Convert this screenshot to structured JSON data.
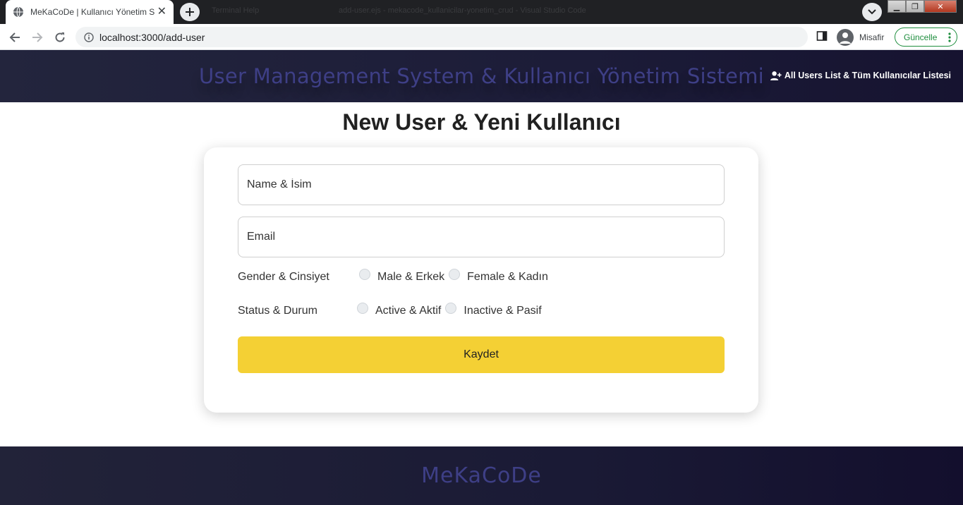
{
  "browser": {
    "tab_title": "MeKaCoDe | Kullanıcı Yönetim Sistemi",
    "url": "localhost:3000/add-user",
    "profile_name": "Misafir",
    "update_label": "Güncelle",
    "ghost_text_1": "Terminal Help",
    "ghost_text_2": "add-user.ejs - mekacode_kullanicilar-yonetim_crud - Visual Studio Code"
  },
  "header": {
    "site_title": "User Management System & Kullanıcı Yönetim Sistemi",
    "nav_link": "All Users List & Tüm Kullanıcılar Listesi"
  },
  "form": {
    "heading": "New User & Yeni Kullanıcı",
    "name_placeholder": "Name & İsim",
    "email_placeholder": "Email",
    "gender_label": "Gender & Cinsiyet",
    "gender_options": [
      "Male & Erkek",
      "Female & Kadın"
    ],
    "status_label": "Status & Durum",
    "status_options": [
      "Active & Aktif",
      "Inactive & Pasif"
    ],
    "submit_label": "Kaydet"
  },
  "footer": {
    "brand": "MeKaCoDe"
  },
  "colors": {
    "header_bg": "#1c1c38",
    "title_color": "#3e3f86",
    "button_yellow": "#f4d034",
    "update_green": "#1e8e3e"
  }
}
